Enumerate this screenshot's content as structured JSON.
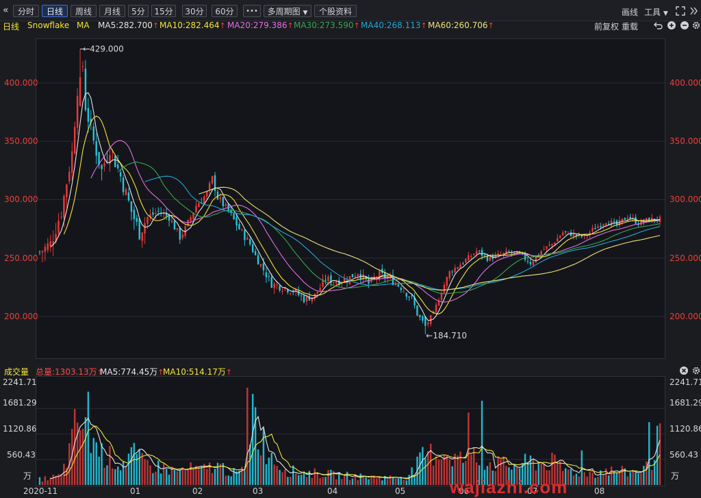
{
  "toolbar": {
    "back_glyph": "«",
    "buttons": [
      "分时",
      "日线",
      "周线",
      "月线",
      "5分",
      "15分",
      "30分",
      "60分",
      "•••"
    ],
    "active": "日线",
    "multi_period": "多周期图",
    "stock_info": "个股资料",
    "draw": "画线",
    "tools": "工具"
  },
  "legend": {
    "period": "日线",
    "name": "Snowflake",
    "ma_label": "MA",
    "items": [
      {
        "label": "MA5:282.700",
        "color": "#e6e6e6"
      },
      {
        "label": "MA10:282.464",
        "color": "#f3e53a"
      },
      {
        "label": "MA20:279.386",
        "color": "#e46fe9"
      },
      {
        "label": "MA30:273.590",
        "color": "#36a852"
      },
      {
        "label": "MA40:268.113",
        "color": "#25a6d8"
      },
      {
        "label": "MA60:260.706",
        "color": "#efe37a"
      }
    ],
    "adjust": "前复权",
    "reload": "重载"
  },
  "price_axis": {
    "ticks": [
      "400.000",
      "350.000",
      "300.000",
      "250.000",
      "200.000"
    ],
    "high_annotation": "429.000",
    "low_annotation": "184.710"
  },
  "volume": {
    "title": "成交量",
    "total": "总量:1303.13万",
    "ma5": "MA5:774.45万",
    "ma10": "MA10:514.17万",
    "ticks": [
      "2241.71",
      "1681.29",
      "1120.86",
      "560.43"
    ],
    "unit": "万"
  },
  "dates": [
    "2020-11",
    "01",
    "02",
    "03",
    "04",
    "05",
    "06",
    "07",
    "08"
  ],
  "watermark": "wajiazhi.com",
  "colors": {
    "up": "#e83a3a",
    "down": "#27c3d8",
    "axis_text": "#e8413c"
  },
  "chart_data": {
    "type": "candlestick",
    "title": "Snowflake 日线",
    "ylim": [
      175,
      440
    ],
    "anchors": [
      [
        0,
        255
      ],
      [
        4,
        262
      ],
      [
        8,
        290
      ],
      [
        12,
        340
      ],
      [
        14,
        395
      ],
      [
        16,
        415
      ],
      [
        17,
        380
      ],
      [
        20,
        350
      ],
      [
        23,
        325
      ],
      [
        26,
        345
      ],
      [
        30,
        320
      ],
      [
        34,
        290
      ],
      [
        37,
        272
      ],
      [
        40,
        285
      ],
      [
        44,
        290
      ],
      [
        48,
        285
      ],
      [
        52,
        268
      ],
      [
        54,
        275
      ],
      [
        58,
        295
      ],
      [
        62,
        305
      ],
      [
        64,
        318
      ],
      [
        66,
        302
      ],
      [
        70,
        290
      ],
      [
        74,
        275
      ],
      [
        78,
        262
      ],
      [
        80,
        252
      ],
      [
        83,
        240
      ],
      [
        86,
        228
      ],
      [
        90,
        225
      ],
      [
        94,
        222
      ],
      [
        98,
        215
      ],
      [
        102,
        218
      ],
      [
        106,
        232
      ],
      [
        110,
        230
      ],
      [
        114,
        232
      ],
      [
        118,
        238
      ],
      [
        122,
        228
      ],
      [
        126,
        236
      ],
      [
        130,
        232
      ],
      [
        134,
        225
      ],
      [
        138,
        215
      ],
      [
        140,
        202
      ],
      [
        143,
        192
      ],
      [
        146,
        202
      ],
      [
        149,
        222
      ],
      [
        152,
        238
      ],
      [
        156,
        245
      ],
      [
        159,
        250
      ],
      [
        162,
        256
      ],
      [
        166,
        250
      ],
      [
        170,
        252
      ],
      [
        174,
        255
      ],
      [
        178,
        253
      ],
      [
        182,
        246
      ],
      [
        186,
        256
      ],
      [
        190,
        262
      ],
      [
        194,
        272
      ],
      [
        198,
        270
      ],
      [
        202,
        268
      ],
      [
        206,
        276
      ],
      [
        210,
        282
      ],
      [
        214,
        278
      ],
      [
        218,
        286
      ],
      [
        222,
        280
      ],
      [
        226,
        283
      ],
      [
        230,
        283
      ]
    ],
    "volume_anchors": [
      [
        0,
        120
      ],
      [
        8,
        200
      ],
      [
        12,
        900
      ],
      [
        14,
        1500
      ],
      [
        17,
        1100
      ],
      [
        20,
        950
      ],
      [
        23,
        700
      ],
      [
        26,
        600
      ],
      [
        30,
        450
      ],
      [
        34,
        700
      ],
      [
        38,
        500
      ],
      [
        42,
        420
      ],
      [
        46,
        380
      ],
      [
        50,
        300
      ],
      [
        56,
        350
      ],
      [
        60,
        320
      ],
      [
        64,
        420
      ],
      [
        68,
        380
      ],
      [
        72,
        260
      ],
      [
        76,
        300
      ],
      [
        79,
        1700
      ],
      [
        81,
        1200
      ],
      [
        84,
        800
      ],
      [
        88,
        500
      ],
      [
        92,
        320
      ],
      [
        96,
        280
      ],
      [
        100,
        260
      ],
      [
        105,
        250
      ],
      [
        110,
        220
      ],
      [
        115,
        200
      ],
      [
        120,
        180
      ],
      [
        126,
        170
      ],
      [
        131,
        160
      ],
      [
        136,
        180
      ],
      [
        139,
        350
      ],
      [
        142,
        600
      ],
      [
        146,
        700
      ],
      [
        150,
        720
      ],
      [
        154,
        600
      ],
      [
        158,
        550
      ],
      [
        162,
        500
      ],
      [
        166,
        480
      ],
      [
        170,
        460
      ],
      [
        174,
        420
      ],
      [
        178,
        430
      ],
      [
        182,
        520
      ],
      [
        186,
        460
      ],
      [
        190,
        500
      ],
      [
        194,
        350
      ],
      [
        198,
        300
      ],
      [
        202,
        270
      ],
      [
        206,
        260
      ],
      [
        210,
        320
      ],
      [
        214,
        300
      ],
      [
        218,
        280
      ],
      [
        222,
        300
      ],
      [
        226,
        450
      ],
      [
        230,
        950
      ]
    ],
    "volume_ylim": [
      0,
      2241.71
    ],
    "ma_periods": [
      5,
      10,
      20,
      30,
      40,
      60
    ],
    "candles_count": 231
  }
}
